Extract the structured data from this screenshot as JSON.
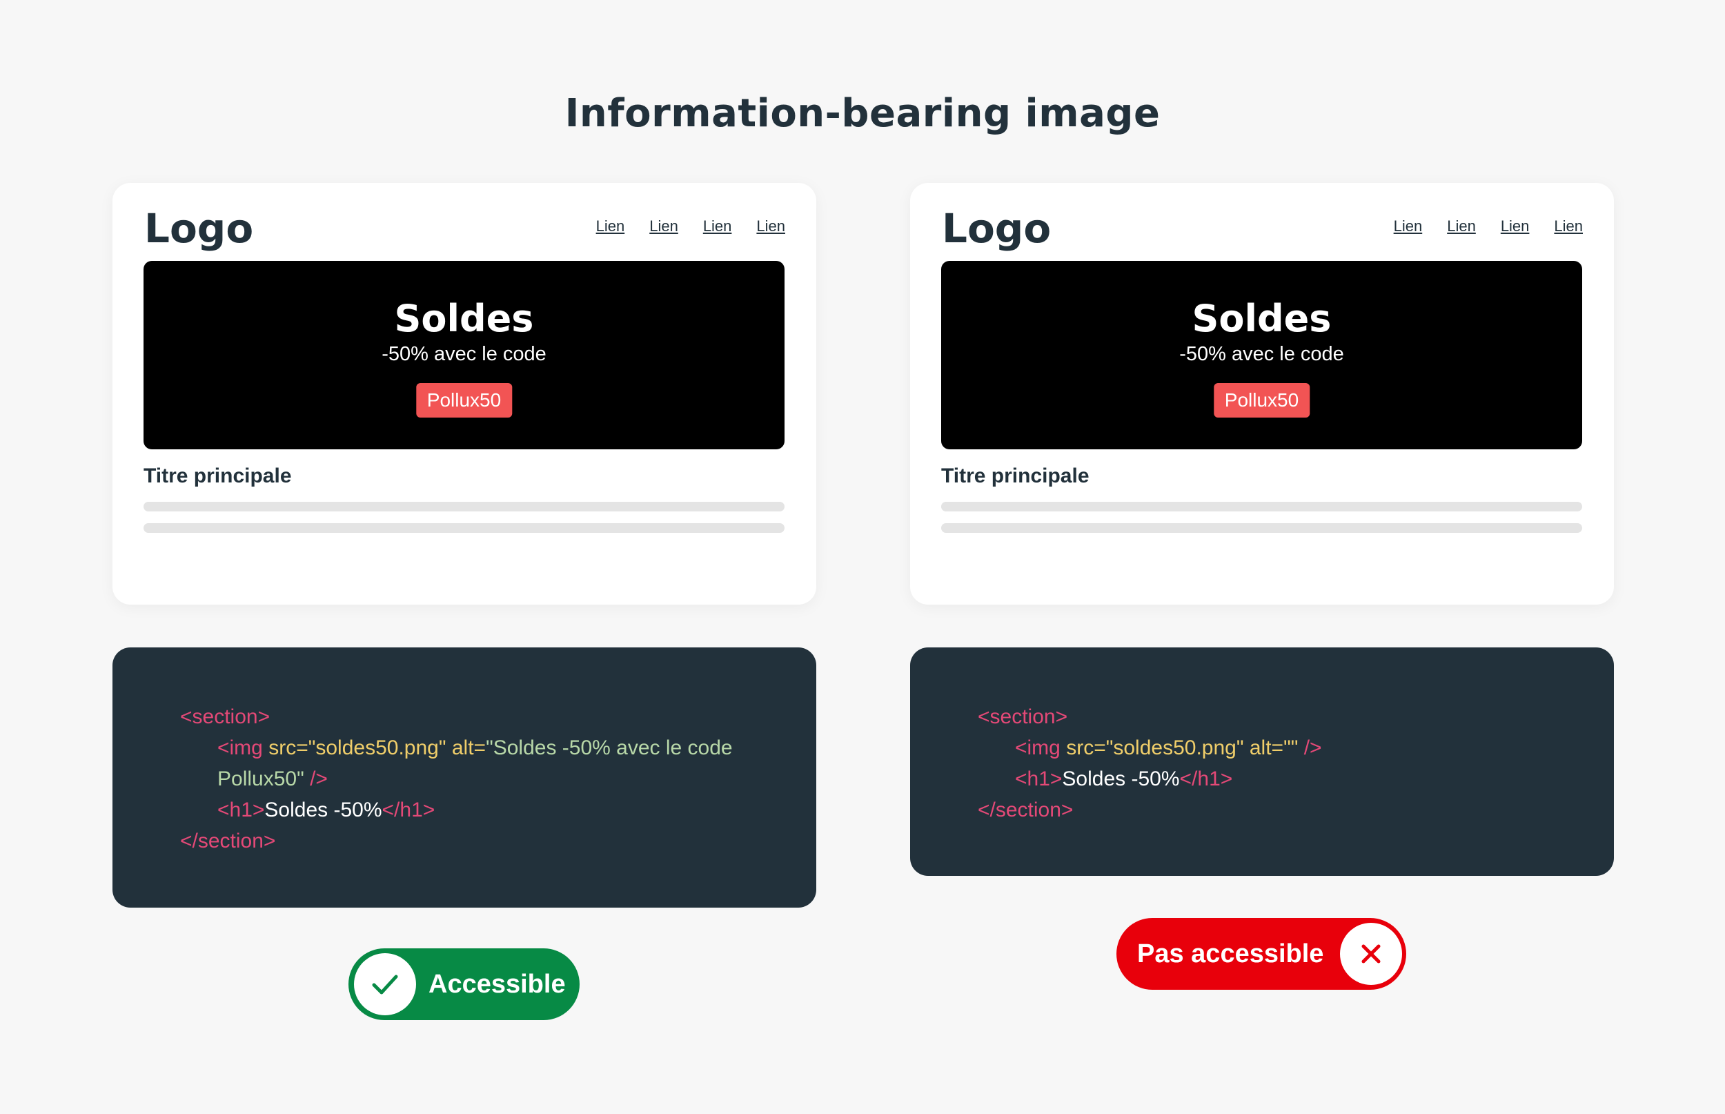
{
  "title": "Information-bearing image",
  "mockup": {
    "logo": "Logo",
    "nav_links": [
      "Lien",
      "Lien",
      "Lien",
      "Lien"
    ],
    "banner": {
      "title": "Soldes",
      "subtitle": "-50% avec le code",
      "code": "Pollux50"
    },
    "heading": "Titre principale"
  },
  "examples": {
    "good": {
      "code": {
        "section_open": "<section>",
        "img_open": "<img ",
        "src_attr": "src=",
        "src_value": "\"soldes50.png\" ",
        "alt_attr": "alt=",
        "alt_value": "\"Soldes -50% avec le code Pollux50\"",
        "img_close": " />",
        "h1_open": "<h1>",
        "h1_text": "Soldes -50%",
        "h1_close": "</h1>",
        "section_close": "</section>"
      },
      "badge_label": "Accessible",
      "badge_icon": "check-icon"
    },
    "bad": {
      "code": {
        "section_open": "<section>",
        "img_open": "<img ",
        "src_attr": "src=",
        "src_value": "\"soldes50.png\" ",
        "alt_attr": "alt=",
        "alt_value": "\"\"",
        "img_close": " />",
        "h1_open": "<h1>",
        "h1_text": "Soldes -50%",
        "h1_close": "</h1>",
        "section_close": "</section>"
      },
      "badge_label": "Pas accessible",
      "badge_icon": "close-icon"
    }
  },
  "colors": {
    "background": "#f7f7f7",
    "text_dark": "#22313b",
    "promo_code": "#f25454",
    "code_bg": "#22313b",
    "code_tag": "#e44977",
    "code_attr": "#f0ce6a",
    "code_value": "#b8d8a8",
    "accessible": "#078a45",
    "not_accessible": "#e8000b"
  }
}
